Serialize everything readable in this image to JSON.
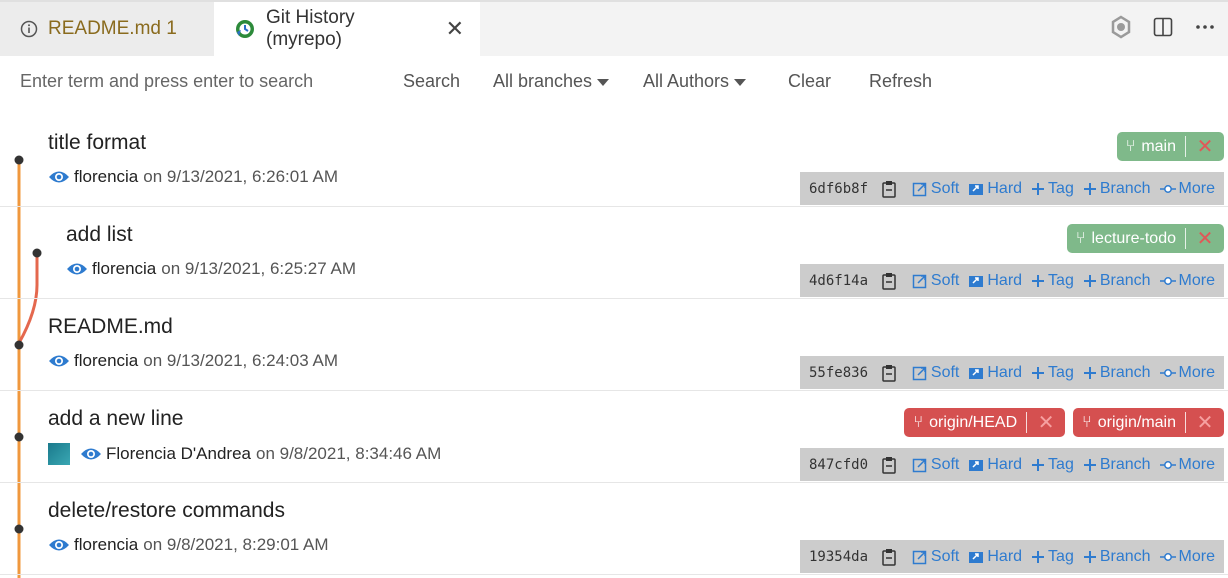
{
  "tabs": [
    {
      "label": "README.md 1",
      "icon": "info-icon",
      "active": false
    },
    {
      "label": "Git History (myrepo)",
      "icon": "git-history-icon",
      "active": true,
      "close": "✕"
    }
  ],
  "tab_actions": [
    "extensions-icon",
    "split-editor-icon",
    "more-actions-icon"
  ],
  "toolbar": {
    "search_placeholder": "Enter term and press enter to search",
    "search_label": "Search",
    "branches_label": "All branches",
    "authors_label": "All Authors",
    "clear_label": "Clear",
    "refresh_label": "Refresh"
  },
  "actions": {
    "soft": "Soft",
    "hard": "Hard",
    "tag": "Tag",
    "branch": "Branch",
    "more": "More",
    "ref_delete": "✕"
  },
  "commits": [
    {
      "subject": "title format",
      "author": "florencia",
      "date": "on 9/13/2021, 6:26:01 AM",
      "hash": "6df6b8f",
      "refs": [
        "main"
      ]
    },
    {
      "subject": "add list",
      "author": "florencia",
      "date": "on 9/13/2021, 6:25:27 AM",
      "hash": "4d6f14a",
      "refs": [
        "lecture-todo"
      ]
    },
    {
      "subject": "README.md",
      "author": "florencia",
      "date": "on 9/13/2021, 6:24:03 AM",
      "hash": "55fe836",
      "refs": []
    },
    {
      "subject": "add a new line",
      "author": "Florencia D'Andrea",
      "date": "on 9/8/2021, 8:34:46 AM",
      "hash": "847cfd0",
      "refs": [
        "origin/HEAD",
        "origin/main"
      ]
    },
    {
      "subject": "delete/restore commands",
      "author": "florencia",
      "date": "on 9/8/2021, 8:29:01 AM",
      "hash": "19354da",
      "refs": []
    }
  ],
  "colors": {
    "main_line": "#f0983e",
    "branch_line": "#e4684e",
    "local_ref": "#7fb98a",
    "remote_ref": "#d55050",
    "link": "#2e7bcf"
  }
}
